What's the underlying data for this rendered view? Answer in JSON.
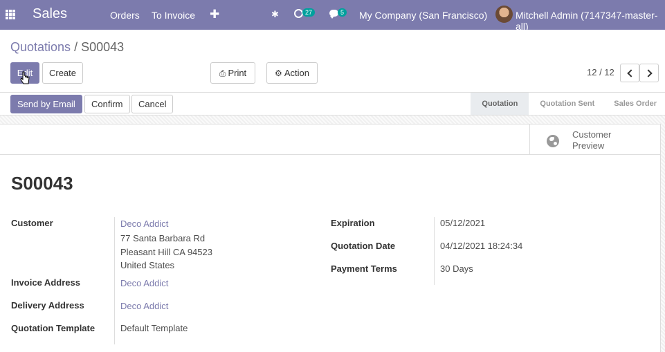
{
  "navbar": {
    "app_name": "Sales",
    "menu": [
      "Orders",
      "To Invoice"
    ],
    "activity_count": "27",
    "message_count": "5",
    "company": "My Company (San Francisco)",
    "user": "Mitchell Admin (7147347-master-all)"
  },
  "breadcrumb": {
    "parent": "Quotations",
    "separator": "/",
    "current": "S00043"
  },
  "toolbar": {
    "edit": "Edit",
    "create": "Create",
    "print": "Print",
    "action": "Action"
  },
  "pager": {
    "value": "12 / 12"
  },
  "statusbar": {
    "send_email": "Send by Email",
    "confirm": "Confirm",
    "cancel": "Cancel",
    "stages": [
      "Quotation",
      "Quotation Sent",
      "Sales Order"
    ],
    "active_stage": "Quotation"
  },
  "preview": {
    "line1": "Customer",
    "line2": "Preview"
  },
  "order": {
    "name": "S00043",
    "customer_label": "Customer",
    "customer": "Deco Addict",
    "address_line1": "77 Santa Barbara Rd",
    "address_line2": "Pleasant Hill CA 94523",
    "address_line3": "United States",
    "invoice_address_label": "Invoice Address",
    "invoice_address": "Deco Addict",
    "delivery_address_label": "Delivery Address",
    "delivery_address": "Deco Addict",
    "template_label": "Quotation Template",
    "template": "Default Template",
    "expiration_label": "Expiration",
    "expiration": "05/12/2021",
    "quotation_date_label": "Quotation Date",
    "quotation_date": "04/12/2021 18:24:34",
    "payment_terms_label": "Payment Terms",
    "payment_terms": "30 Days"
  },
  "colors": {
    "brand": "#7c7bad",
    "badge": "#00a09d"
  }
}
